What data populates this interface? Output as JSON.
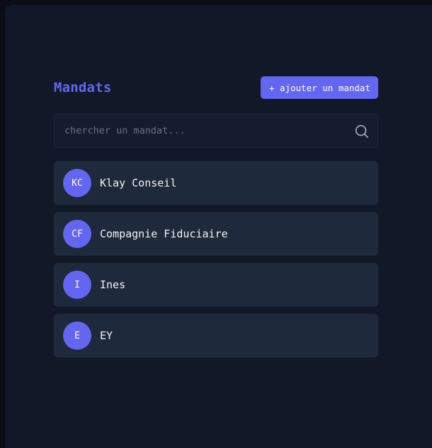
{
  "header": {
    "title": "Mandats",
    "add_button_label": "+ ajouter un mandat"
  },
  "search": {
    "placeholder": "chercher un mandat...",
    "value": "",
    "icon": "search-icon"
  },
  "mandates": [
    {
      "initials": "KC",
      "name": "Klay Conseil"
    },
    {
      "initials": "CF",
      "name": "Compagnie Fiduciaire"
    },
    {
      "initials": "I",
      "name": "Ines"
    },
    {
      "initials": "E",
      "name": "EY"
    }
  ],
  "colors": {
    "accent": "#6366f1",
    "background": "#111827",
    "card": "#1e293b",
    "text": "#f3f4f6",
    "placeholder": "#6b7280"
  }
}
